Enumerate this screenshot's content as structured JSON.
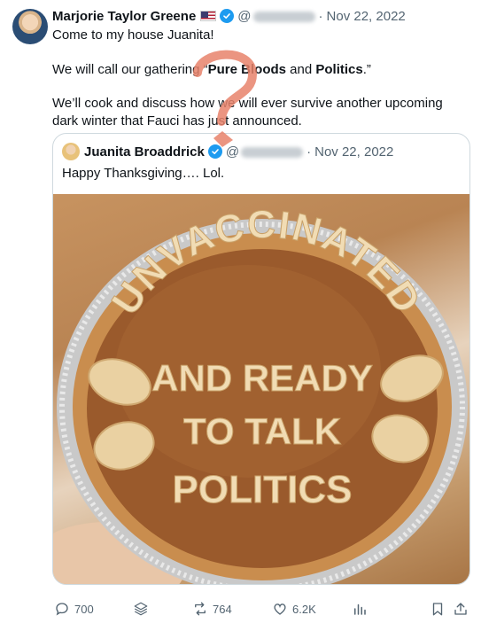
{
  "post": {
    "author_name": "Marjorie Taylor Greene",
    "handle_prefix": "@",
    "date": "Nov 22, 2022",
    "separator": "·",
    "line1": "Come to my house Juanita!",
    "line2_pre": "We will call our gathering “",
    "line2_bold1": "Pure Bloods",
    "line2_mid": " and ",
    "line2_bold2": "Politics",
    "line2_post": ".”",
    "line3": "We’ll cook and discuss how we will ever survive another upcoming dark winter that Fauci has just announced."
  },
  "quoted": {
    "author_name": "Juanita Broaddrick",
    "handle_prefix": "@",
    "date": "Nov 22, 2022",
    "separator": "·",
    "text": "Happy Thanksgiving…. Lol."
  },
  "pie_text": {
    "arc": "UNVACCINATED",
    "line1": "AND READY",
    "line2": "TO TALK",
    "line3": "POLITICS"
  },
  "actions": {
    "replies": "700",
    "retweets": "764",
    "likes": "6.2K"
  },
  "colors": {
    "accent": "#1d9bf0",
    "muted": "#536471",
    "annotation": "#e8836b"
  },
  "icons": [
    "verified-icon",
    "flag-icon",
    "reply-icon",
    "layers-icon",
    "retweet-icon",
    "like-icon",
    "views-icon",
    "bookmark-icon",
    "share-icon"
  ]
}
